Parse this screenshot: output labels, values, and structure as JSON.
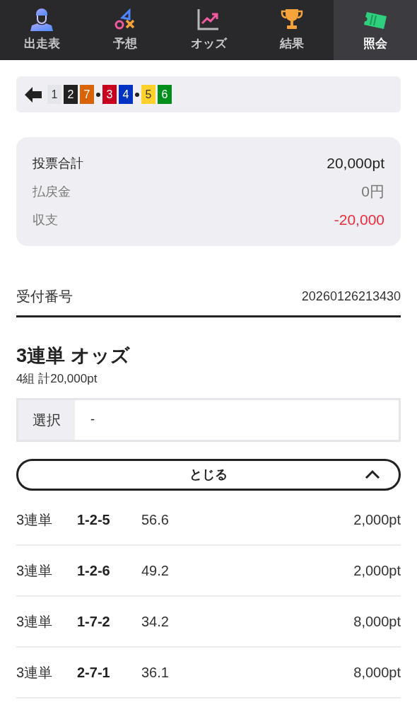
{
  "tabs": [
    {
      "label": "出走表",
      "selected": false
    },
    {
      "label": "予想",
      "selected": false
    },
    {
      "label": "オッズ",
      "selected": false
    },
    {
      "label": "結果",
      "selected": false
    },
    {
      "label": "照会",
      "selected": true
    }
  ],
  "posts": [
    [
      {
        "number": "1",
        "color": "#e5e6ea"
      },
      {
        "number": "2",
        "color": "#222222"
      },
      {
        "number": "7",
        "color": "#d96407"
      }
    ],
    [
      {
        "number": "3",
        "color": "#c8001e"
      },
      {
        "number": "4",
        "color": "#0033c4"
      }
    ],
    [
      {
        "number": "5",
        "color": "#ffd12a"
      },
      {
        "number": "6",
        "color": "#008f1a"
      }
    ]
  ],
  "summary": [
    {
      "label": "投票合計",
      "value": "20,000pt",
      "kind": "total",
      "negative": false
    },
    {
      "label": "払戻金",
      "value": "0円",
      "kind": "detail",
      "negative": false
    },
    {
      "label": "収支",
      "value": "-20,000",
      "kind": "detail",
      "negative": true
    }
  ],
  "receipt": {
    "label": "受付番号",
    "value": "20260126213430"
  },
  "bet": {
    "title": "3連単 オッズ",
    "subtitle": "4組 計20,000pt",
    "selection_label": "選択",
    "selection_value": "-",
    "toggle": "とじる",
    "expanded": true
  },
  "rows": [
    {
      "type": "3連単",
      "combo": "1-2-5",
      "odds": "56.6",
      "amount": "2,000pt"
    },
    {
      "type": "3連単",
      "combo": "1-2-6",
      "odds": "49.2",
      "amount": "2,000pt"
    },
    {
      "type": "3連単",
      "combo": "1-7-2",
      "odds": "34.2",
      "amount": "8,000pt"
    },
    {
      "type": "3連単",
      "combo": "2-7-1",
      "odds": "36.1",
      "amount": "8,000pt"
    }
  ]
}
